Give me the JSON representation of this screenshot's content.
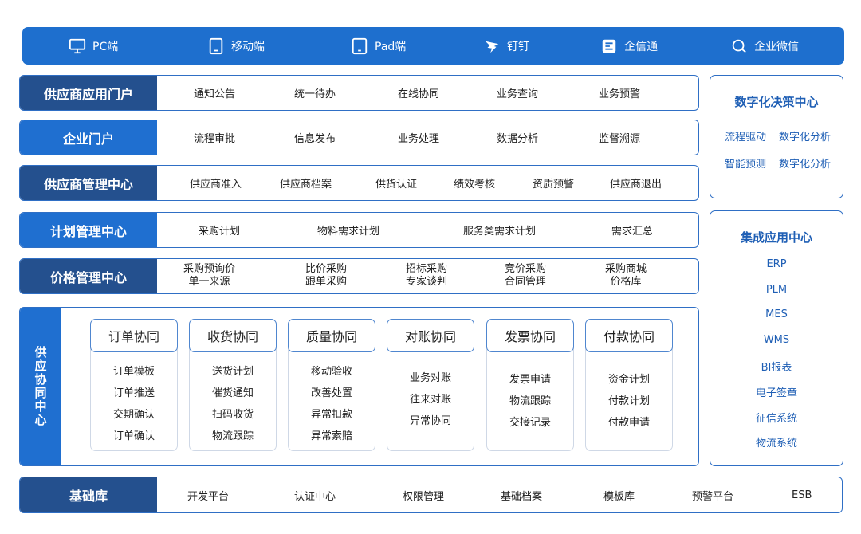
{
  "platforms": [
    {
      "label": "PC端",
      "icon": "monitor-icon"
    },
    {
      "label": "移动端",
      "icon": "mobile-icon"
    },
    {
      "label": "Pad端",
      "icon": "tablet-icon"
    },
    {
      "label": "钉钉",
      "icon": "dingtalk-icon"
    },
    {
      "label": "企信通",
      "icon": "qixintong-icon"
    },
    {
      "label": "企业微信",
      "icon": "wecom-icon"
    }
  ],
  "rows": [
    {
      "label": "供应商应用门户",
      "items": [
        "通知公告",
        "统一待办",
        "在线协同",
        "业务查询",
        "业务预警"
      ]
    },
    {
      "label": "企业门户",
      "items": [
        "流程审批",
        "信息发布",
        "业务处理",
        "数据分析",
        "监督溯源"
      ]
    },
    {
      "label": "供应商管理中心",
      "items": [
        "供应商准入",
        "供应商档案",
        "供货认证",
        "绩效考核",
        "资质预警",
        "供应商退出"
      ]
    },
    {
      "label": "计划管理中心",
      "items": [
        "采购计划",
        "物料需求计划",
        "服务类需求计划",
        "需求汇总"
      ]
    },
    {
      "label": "价格管理中心",
      "items": [
        [
          "采购预询价",
          "单一来源"
        ],
        [
          "比价采购",
          "跟单采购"
        ],
        [
          "招标采购",
          "专家谈判"
        ],
        [
          "竞价采购",
          "合同管理"
        ],
        [
          "采购商城",
          "价格库"
        ]
      ]
    }
  ],
  "collab": {
    "label": "供应协同中心",
    "cards": [
      {
        "title": "订单协同",
        "items": [
          "订单模板",
          "订单推送",
          "交期确认",
          "订单确认"
        ]
      },
      {
        "title": "收货协同",
        "items": [
          "送货计划",
          "催货通知",
          "扫码收货",
          "物流跟踪"
        ]
      },
      {
        "title": "质量协同",
        "items": [
          "移动验收",
          "改善处置",
          "异常扣款",
          "异常索赔"
        ]
      },
      {
        "title": "对账协同",
        "items": [
          "业务对账",
          "往来对账",
          "异常协同"
        ]
      },
      {
        "title": "发票协同",
        "items": [
          "发票申请",
          "物流跟踪",
          "交接记录"
        ]
      },
      {
        "title": "付款协同",
        "items": [
          "资金计划",
          "付款计划",
          "付款申请"
        ]
      }
    ]
  },
  "decision": {
    "title": "数字化决策中心",
    "items": [
      [
        "流程驱动",
        "数字化分析"
      ],
      [
        "智能预测",
        "数字化分析"
      ]
    ]
  },
  "integration": {
    "title": "集成应用中心",
    "items": [
      "ERP",
      "PLM",
      "MES",
      "WMS",
      "BI报表",
      "电子签章",
      "征信系统",
      "物流系统"
    ]
  },
  "base": {
    "label": "基础库",
    "items": [
      "开发平台",
      "认证中心",
      "权限管理",
      "基础档案",
      "模板库",
      "预警平台",
      "ESB"
    ]
  }
}
